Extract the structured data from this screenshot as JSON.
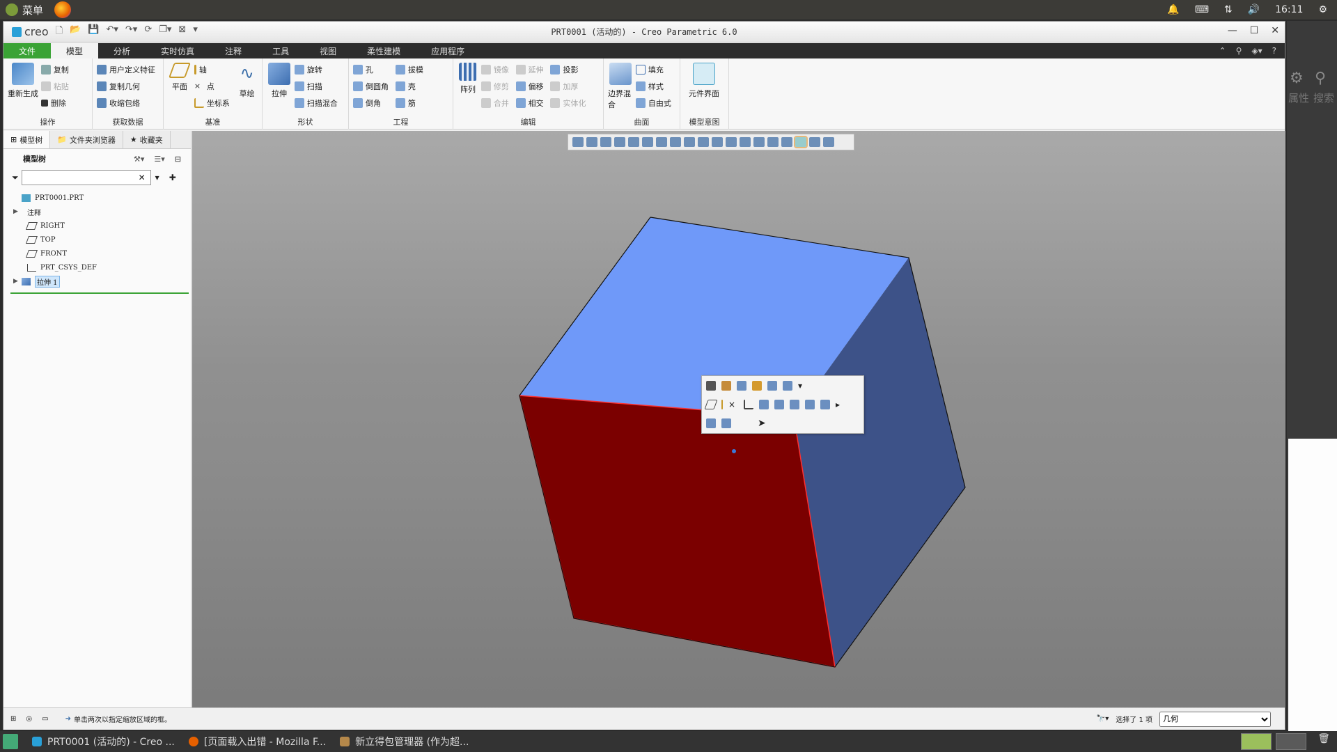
{
  "system_bar": {
    "menu_label": "菜单",
    "clock": "16:11"
  },
  "window": {
    "title": "PRT0001 (活动的) - Creo Parametric 6.0",
    "logo": "creo"
  },
  "ribbon_tabs": [
    "文件",
    "模型",
    "分析",
    "实时仿真",
    "注释",
    "工具",
    "视图",
    "柔性建模",
    "应用程序"
  ],
  "ribbon": {
    "operations": {
      "label": "操作",
      "regenerate": "重新生成",
      "copy": "复制",
      "paste": "粘贴",
      "delete": "删除"
    },
    "get_data": {
      "label": "获取数据",
      "udf": "用户定义特征",
      "copy_geom": "复制几何",
      "shrinkwrap": "收缩包络"
    },
    "datum": {
      "label": "基准",
      "plane": "平面",
      "axis": "轴",
      "point": "点",
      "csys": "坐标系",
      "sketch": "草绘"
    },
    "shapes": {
      "label": "形状",
      "extrude": "拉伸",
      "revolve": "旋转",
      "sweep": "扫描",
      "swept_blend": "扫描混合"
    },
    "engineering": {
      "label": "工程",
      "hole": "孔",
      "round": "倒圆角",
      "chamfer": "倒角",
      "draft": "拔模",
      "shell": "壳",
      "rib": "筋"
    },
    "editing": {
      "label": "编辑",
      "pattern": "阵列",
      "mirror": "镜像",
      "trim": "修剪",
      "merge": "合并",
      "extend": "延伸",
      "offset": "偏移",
      "intersect": "相交",
      "project": "投影",
      "thicken": "加厚",
      "solidify": "实体化"
    },
    "surfaces": {
      "label": "曲面",
      "boundary_blend": "边界混合",
      "fill": "填充",
      "style": "样式",
      "freestyle": "自由式"
    },
    "model_intent": {
      "label": "模型意图",
      "component_interface": "元件界面"
    }
  },
  "left_panel": {
    "tabs": [
      "模型树",
      "文件夹浏览器",
      "收藏夹"
    ],
    "tree_header": "模型树",
    "filter_placeholder": "",
    "items": [
      {
        "label": "PRT0001.PRT",
        "expandable": false
      },
      {
        "label": "注释",
        "expandable": true
      },
      {
        "label": "RIGHT",
        "expandable": false
      },
      {
        "label": "TOP",
        "expandable": false
      },
      {
        "label": "FRONT",
        "expandable": false
      },
      {
        "label": "PRT_CSYS_DEF",
        "expandable": false
      },
      {
        "label": "拉伸 1",
        "expandable": true,
        "selected": true
      }
    ]
  },
  "status_bar": {
    "message": "单击两次以指定缩放区域的框。",
    "selection": "选择了 1 项",
    "filter_value": "几何"
  },
  "taskbar": {
    "tasks": [
      "PRT0001 (活动的) - Creo ...",
      "[页面载入出错 - Mozilla F...",
      "新立得包管理器 (作为超..."
    ]
  },
  "right_panel": {
    "labels": [
      "属性",
      "搜索"
    ]
  },
  "colors": {
    "cube_top": "#6f99f9",
    "cube_front": "#7b0000",
    "cube_right": "#3d5288",
    "ribbon_file_tab": "#3aa335"
  }
}
